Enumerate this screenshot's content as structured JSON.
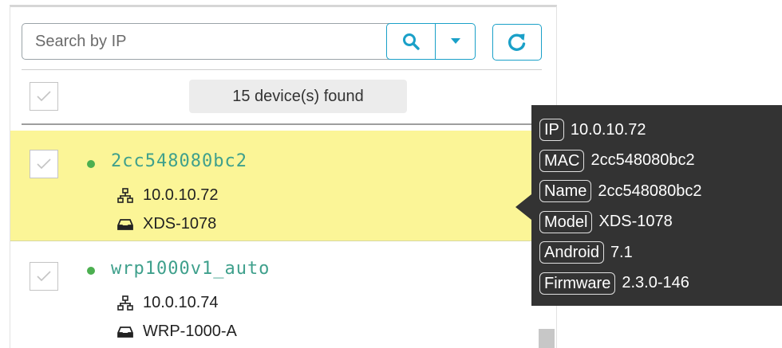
{
  "search": {
    "placeholder": "Search by IP"
  },
  "toolbar": {
    "search_icon": "search-icon",
    "dropdown_icon": "caret-down-icon",
    "refresh_icon": "refresh-icon",
    "accent_color": "#1aa0c8"
  },
  "list": {
    "count_label": "15 device(s) found",
    "devices": [
      {
        "name": "2cc548080bc2",
        "ip": "10.0.10.72",
        "model": "XDS-1078",
        "status_color": "#4caf50",
        "highlighted": true
      },
      {
        "name": "wrp1000v1_auto",
        "ip": "10.0.10.74",
        "model": "WRP-1000-A",
        "status_color": "#4caf50",
        "highlighted": false
      }
    ]
  },
  "tooltip": {
    "rows": [
      {
        "key": "IP",
        "value": "10.0.10.72"
      },
      {
        "key": "MAC",
        "value": "2cc548080bc2"
      },
      {
        "key": "Name",
        "value": "2cc548080bc2"
      },
      {
        "key": "Model",
        "value": "XDS-1078"
      },
      {
        "key": "Android",
        "value": "7.1"
      },
      {
        "key": "Firmware",
        "value": "2.3.0-146"
      }
    ]
  },
  "colors": {
    "highlight_row": "#fbf597",
    "device_name": "#3fa08c",
    "tooltip_bg": "#333333"
  }
}
